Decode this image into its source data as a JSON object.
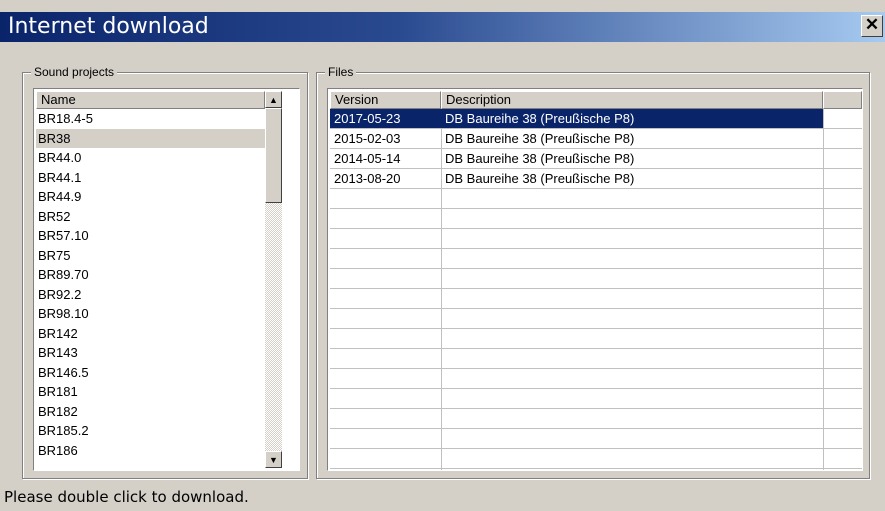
{
  "window": {
    "title": "Internet download",
    "close_label": "✕"
  },
  "sound_projects": {
    "group_label": "Sound projects",
    "column_header": "Name",
    "selected_index": 1,
    "items": [
      "BR18.4-5",
      "BR38",
      "BR44.0",
      "BR44.1",
      "BR44.9",
      "BR52",
      "BR57.10",
      "BR75",
      "BR89.70",
      "BR92.2",
      "BR98.10",
      "BR142",
      "BR143",
      "BR146.5",
      "BR181",
      "BR182",
      "BR185.2",
      "BR186"
    ]
  },
  "files": {
    "group_label": "Files",
    "columns": [
      "Version",
      "Description"
    ],
    "selected_index": 0,
    "rows": [
      {
        "version": "2017-05-23",
        "description": "DB Baureihe 38 (Preußische P8)"
      },
      {
        "version": "2015-02-03",
        "description": "DB Baureihe 38 (Preußische P8)"
      },
      {
        "version": "2014-05-14",
        "description": "DB Baureihe 38 (Preußische P8)"
      },
      {
        "version": "2013-08-20",
        "description": "DB Baureihe 38 (Preußische P8)"
      }
    ]
  },
  "status": {
    "text": "Please double click to download."
  },
  "colors": {
    "selection": "#0a246a",
    "listbox_selection_gray": "#d4d0c8"
  }
}
